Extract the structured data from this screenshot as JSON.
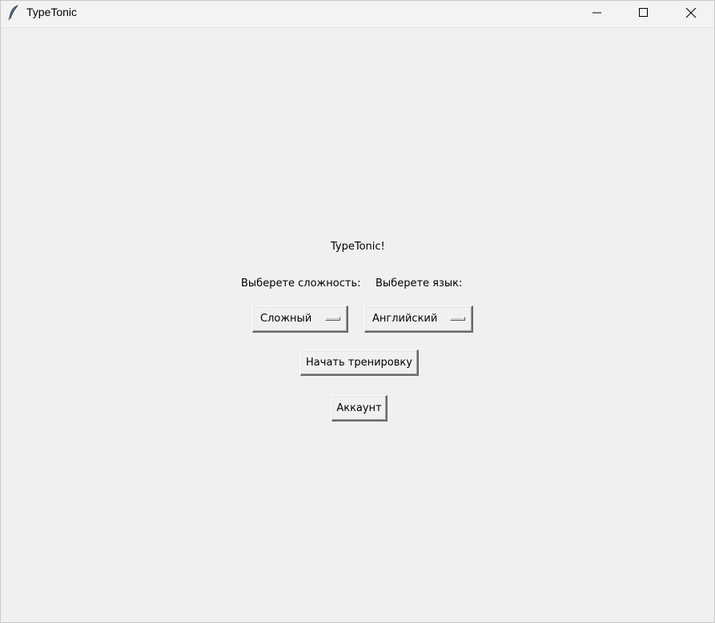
{
  "window": {
    "title": "TypeTonic",
    "icon": "feather-icon",
    "controls": [
      "minimize-icon",
      "maximize-icon",
      "close-icon"
    ]
  },
  "main": {
    "app_title": "TypeTonic!",
    "difficulty_label": "Выберете сложность:",
    "language_label": "Выберете язык:",
    "difficulty_selected": "Сложный",
    "language_selected": "Английский",
    "start_button": "Начать тренировку",
    "account_button": "Аккаунт"
  },
  "colors": {
    "background": "#f0f0f0",
    "titlebar": "#f3f3f3"
  }
}
